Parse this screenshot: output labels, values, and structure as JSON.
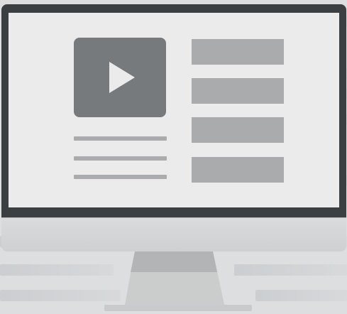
{
  "illustration": {
    "subject": "monitor-icon",
    "screen_icon": "play-icon"
  },
  "colors": {
    "bezel": "#3c3f41",
    "screen": "#ebebeb",
    "placeholder": "#a9abad",
    "video_tile": "#777a7c",
    "chin": "#d5d6d7",
    "stand": "#c4c5c6"
  }
}
